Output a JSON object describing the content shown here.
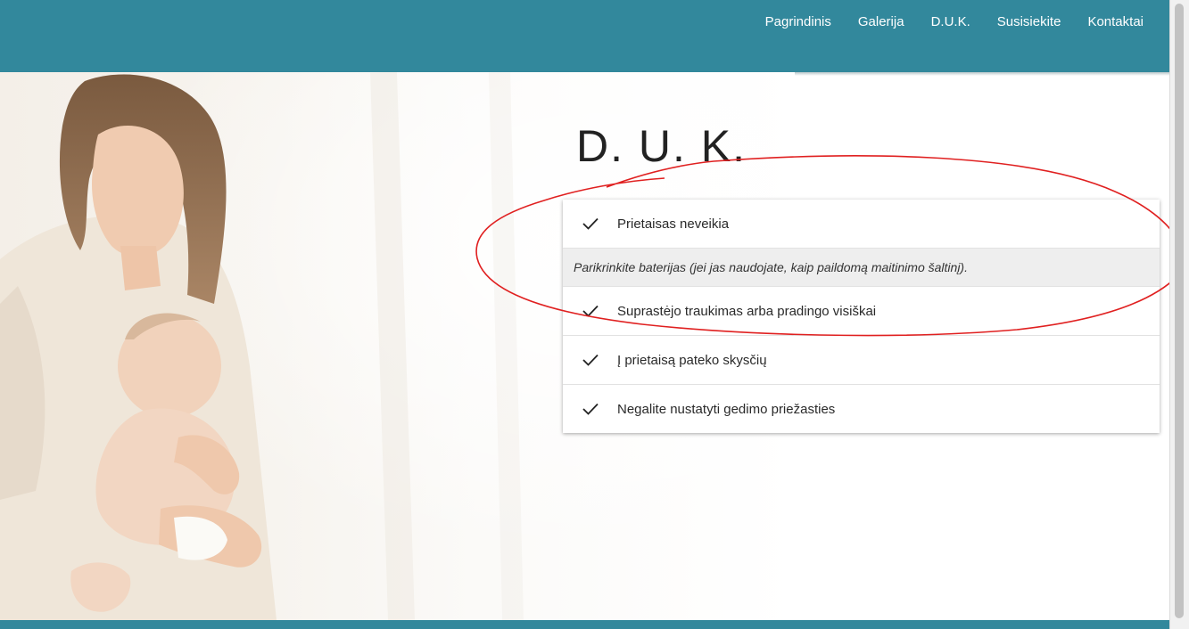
{
  "nav": {
    "items": [
      {
        "label": "Pagrindinis"
      },
      {
        "label": "Galerija"
      },
      {
        "label": "D.U.K."
      },
      {
        "label": "Susisiekite"
      },
      {
        "label": "Kontaktai"
      }
    ]
  },
  "page": {
    "title": "D. U. K."
  },
  "faq": {
    "items": [
      {
        "question": "Prietaisas neveikia",
        "expanded": true,
        "answer": "Parikrinkite baterijas (jei jas naudojate, kaip paildomą maitinimo šaltinį)."
      },
      {
        "question": "Suprastėjo traukimas arba pradingo visiškai"
      },
      {
        "question": "Į prietaisą pateko skysčių"
      },
      {
        "question": "Negalite nustatyti gedimo priežasties"
      }
    ],
    "icon": "check-icon"
  },
  "colors": {
    "header": "#32889c",
    "annotation": "#e02020"
  }
}
